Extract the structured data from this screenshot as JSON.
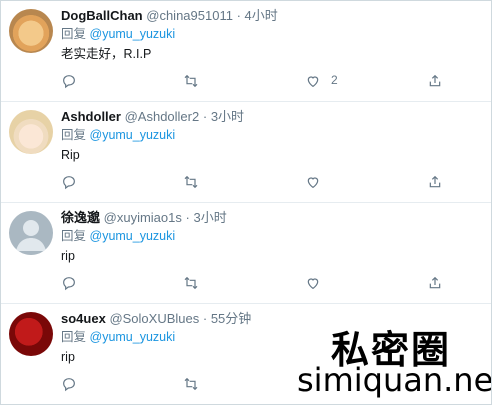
{
  "tweets": [
    {
      "name": "DogBallChan",
      "handle": "@china951011",
      "time": "4小时",
      "reply_prefix": "回复",
      "reply_to": "@yumu_yuzuki",
      "text": "老实走好，R.I.P",
      "like_count": "2",
      "avatar": "dog-avatar"
    },
    {
      "name": "Ashdoller",
      "handle": "@Ashdoller2",
      "time": "3小时",
      "reply_prefix": "回复",
      "reply_to": "@yumu_yuzuki",
      "text": "Rip",
      "like_count": "",
      "avatar": "anime-avatar"
    },
    {
      "name": "徐逸邈",
      "handle": "@xuyimiao1s",
      "time": "3小时",
      "reply_prefix": "回复",
      "reply_to": "@yumu_yuzuki",
      "text": "rip",
      "like_count": "",
      "avatar": "default-avatar"
    },
    {
      "name": "so4uex",
      "handle": "@SoloXUBlues",
      "time": "55分钟",
      "reply_prefix": "回复",
      "reply_to": "@yumu_yuzuki",
      "text": "rip",
      "like_count": "",
      "avatar": "red-avatar"
    }
  ],
  "separator": "·",
  "watermark": {
    "line1": "私密圈",
    "line2": "simiquan.net"
  },
  "icons": {
    "reply": "reply-icon",
    "retweet": "retweet-icon",
    "like": "heart-icon",
    "share": "share-icon"
  },
  "colors": {
    "text": "#14171a",
    "muted": "#657786",
    "link": "#1b95e0",
    "divider": "#e6ecf0"
  }
}
